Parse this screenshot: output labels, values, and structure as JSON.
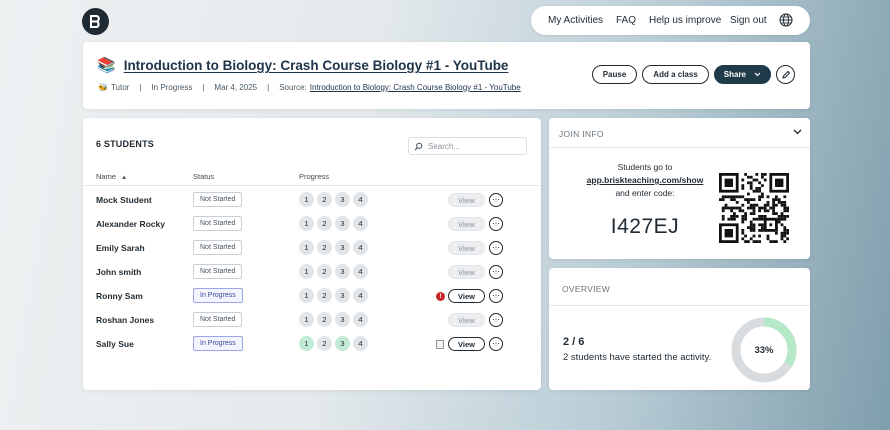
{
  "nav": {
    "my_activities": "My Activities",
    "faq": "FAQ",
    "help": "Help us improve",
    "sign_out": "Sign out"
  },
  "activity": {
    "title": "Introduction to Biology: Crash Course Biology #1 - YouTube",
    "type": "Tutor",
    "status": "In Progress",
    "date": "Mar 4, 2025",
    "source_label": "Source:",
    "source_link": "Introduction to Biology: Crash Course Biology #1 - YouTube",
    "sep": "|"
  },
  "actions": {
    "pause": "Pause",
    "add_class": "Add a class",
    "share": "Share"
  },
  "students": {
    "title": "6 STUDENTS",
    "search_placeholder": "Search...",
    "columns": {
      "name": "Name",
      "sort": "▲",
      "status": "Status",
      "progress": "Progress"
    },
    "rows": [
      {
        "name": "Mock Student",
        "status": "Not Started",
        "steps": [
          "1",
          "2",
          "3",
          "4"
        ],
        "done": [
          false,
          false,
          false,
          false
        ],
        "view": "View",
        "more": "⋯",
        "view_active": false,
        "icon": ""
      },
      {
        "name": "Alexander Rocky",
        "status": "Not Started",
        "steps": [
          "1",
          "2",
          "3",
          "4"
        ],
        "done": [
          false,
          false,
          false,
          false
        ],
        "view": "View",
        "more": "⋯",
        "view_active": false,
        "icon": ""
      },
      {
        "name": "Emily Sarah",
        "status": "Not Started",
        "steps": [
          "1",
          "2",
          "3",
          "4"
        ],
        "done": [
          false,
          false,
          false,
          false
        ],
        "view": "View",
        "more": "⋯",
        "view_active": false,
        "icon": ""
      },
      {
        "name": "John smith",
        "status": "Not Started",
        "steps": [
          "1",
          "2",
          "3",
          "4"
        ],
        "done": [
          false,
          false,
          false,
          false
        ],
        "view": "View",
        "more": "⋯",
        "view_active": false,
        "icon": ""
      },
      {
        "name": "Ronny Sam",
        "status": "In Progress",
        "steps": [
          "1",
          "2",
          "3",
          "4"
        ],
        "done": [
          false,
          false,
          false,
          false
        ],
        "view": "View",
        "more": "⋯",
        "view_active": true,
        "icon": "alert"
      },
      {
        "name": "Roshan Jones",
        "status": "Not Started",
        "steps": [
          "1",
          "2",
          "3",
          "4"
        ],
        "done": [
          false,
          false,
          false,
          false
        ],
        "view": "View",
        "more": "⋯",
        "view_active": false,
        "icon": ""
      },
      {
        "name": "Sally Sue",
        "status": "In Progress",
        "steps": [
          "1",
          "2",
          "3",
          "4"
        ],
        "done": [
          true,
          false,
          true,
          false
        ],
        "view": "View",
        "more": "⋯",
        "view_active": true,
        "icon": "doc"
      }
    ]
  },
  "join": {
    "title": "JOIN INFO",
    "line1": "Students go to",
    "url": "app.briskteaching.com/show",
    "line2": "and enter code:",
    "code": "I427EJ"
  },
  "overview": {
    "title": "OVERVIEW",
    "count": "2 / 6",
    "description": "2 students have started the activity.",
    "percent_label": "33%",
    "fraction": 0.333
  },
  "colors": {
    "accent_dark": "#1f3a48",
    "done_green": "#c3ead5",
    "donut_fill": "#b5e8c7",
    "donut_track": "#d9dcdf"
  }
}
